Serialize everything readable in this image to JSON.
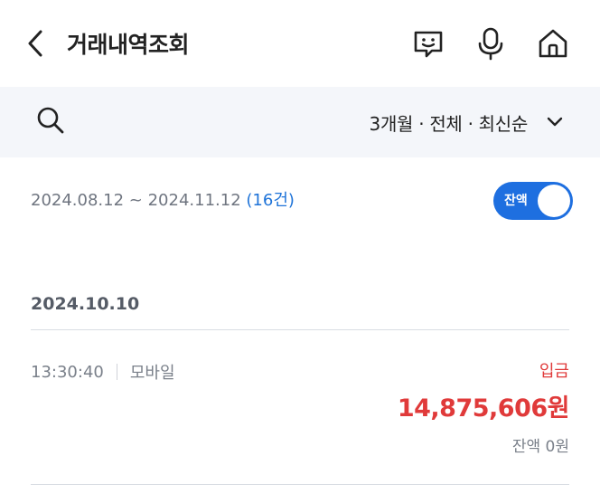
{
  "header": {
    "title": "거래내역조회",
    "icons": [
      "back-chevron-icon",
      "chat-smile-icon",
      "microphone-icon",
      "home-icon"
    ]
  },
  "filter": {
    "summary": "3개월 · 전체 · 최신순",
    "icons": [
      "search-icon",
      "chevron-down-icon"
    ]
  },
  "range": {
    "text": "2024.08.12 ~ 2024.11.12",
    "count": "(16건)"
  },
  "balance_toggle": {
    "label": "잔액",
    "state": "on"
  },
  "transactions": [
    {
      "date": "2024.10.10",
      "time": "13:30:40",
      "channel": "모바일",
      "type": "입금",
      "amount": "14,875,606원",
      "balance": "잔액 0원"
    }
  ],
  "colors": {
    "accent_blue": "#1e6fe0",
    "deposit_red": "#e03a3a",
    "filter_bg": "#f4f6fa",
    "muted_text": "#7a808a"
  }
}
